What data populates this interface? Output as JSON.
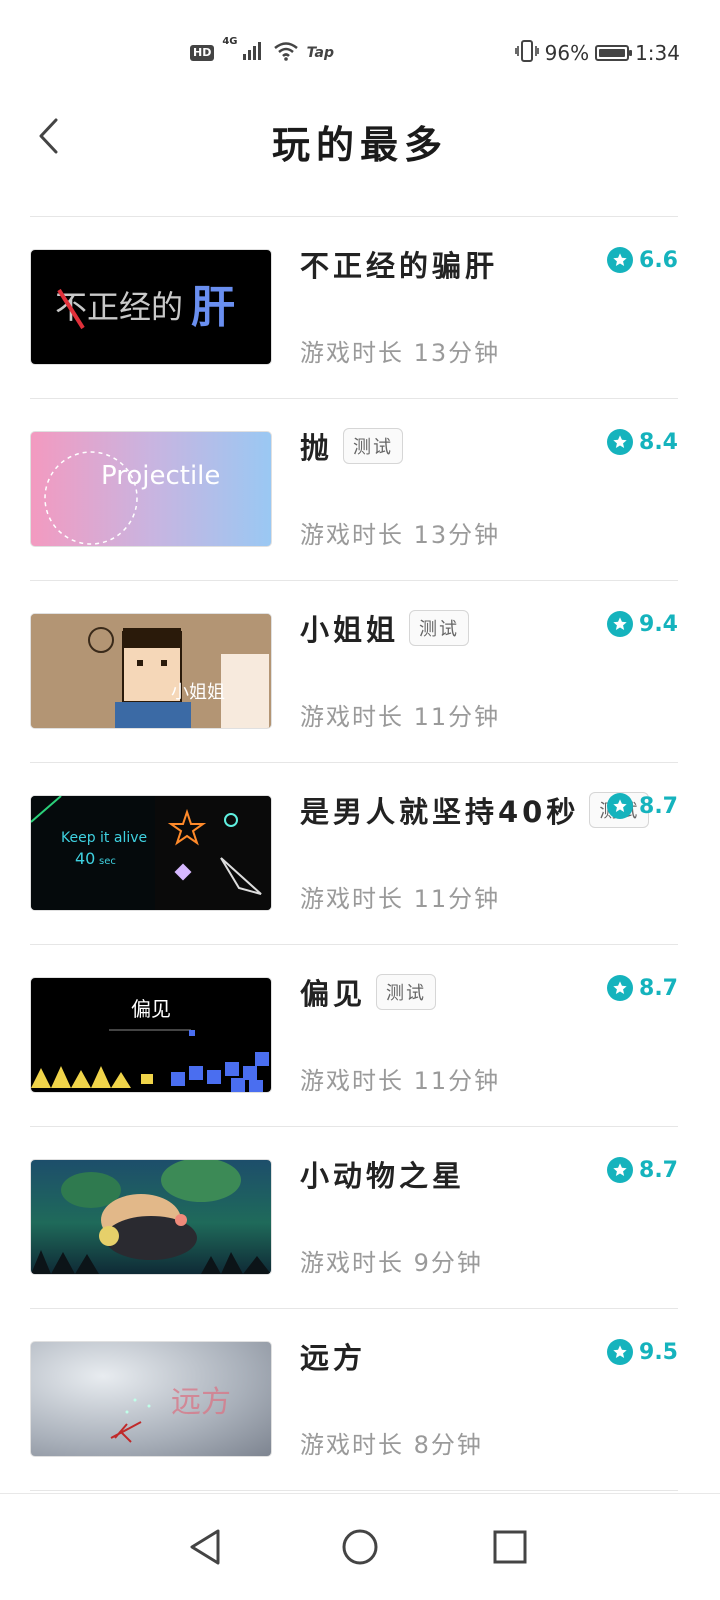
{
  "status_bar": {
    "network_badge": "HD",
    "network_type": "4G",
    "carrier_label": "Tap",
    "battery_percent": "96%",
    "time": "1:34"
  },
  "header": {
    "title": "玩的最多",
    "back_icon": "chevron-left-icon"
  },
  "accent_color": "#15b3bd",
  "games": [
    {
      "title": "不正经的骗肝",
      "tag": "",
      "playtime": "游戏时长 13分钟",
      "rating": "6.6",
      "thumb_text": [
        "不正经的",
        "肝"
      ]
    },
    {
      "title": "抛",
      "tag": "测试",
      "playtime": "游戏时长 13分钟",
      "rating": "8.4",
      "thumb_text": [
        "Projectile"
      ]
    },
    {
      "title": "小姐姐",
      "tag": "测试",
      "playtime": "游戏时长 11分钟",
      "rating": "9.4",
      "thumb_text": [
        "小姐姐"
      ]
    },
    {
      "title": "是男人就坚持40秒",
      "tag": "测试",
      "playtime": "游戏时长 11分钟",
      "rating": "8.7",
      "thumb_text": [
        "Keep it alive",
        "40",
        "sec"
      ]
    },
    {
      "title": "偏见",
      "tag": "测试",
      "playtime": "游戏时长 11分钟",
      "rating": "8.7",
      "thumb_text": [
        "偏见"
      ]
    },
    {
      "title": "小动物之星",
      "tag": "",
      "playtime": "游戏时长 9分钟",
      "rating": "8.7",
      "thumb_text": []
    },
    {
      "title": "远方",
      "tag": "",
      "playtime": "游戏时长 8分钟",
      "rating": "9.5",
      "thumb_text": [
        "远方"
      ]
    }
  ],
  "nav_bar": {
    "back": "triangle-back-icon",
    "home": "circle-home-icon",
    "recents": "square-recents-icon"
  }
}
